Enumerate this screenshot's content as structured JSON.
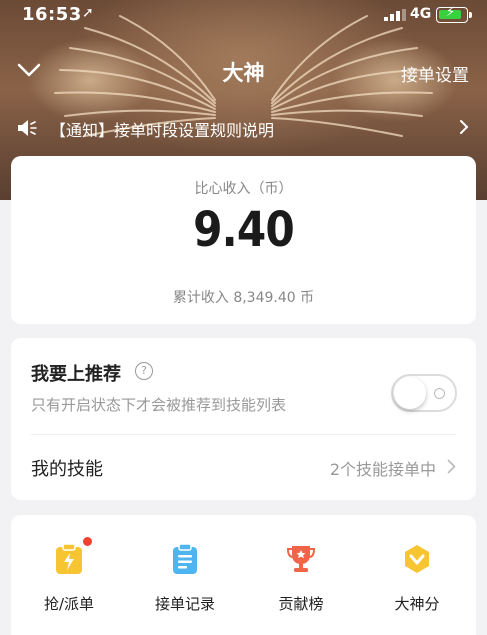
{
  "status_bar": {
    "time": "16:53",
    "network": "4G"
  },
  "nav": {
    "title": "大神",
    "right_action": "接单设置"
  },
  "notice": {
    "text": "【通知】接单时段设置规则说明"
  },
  "income": {
    "label": "比心收入（币）",
    "value": "9.40",
    "total_text": "累计收入 8,349.40 币"
  },
  "recommend": {
    "title": "我要上推荐",
    "help_symbol": "?",
    "description": "只有开启状态下才会被推荐到技能列表",
    "enabled": false
  },
  "skills": {
    "label": "我的技能",
    "count_text": "2个技能接单中"
  },
  "tools": [
    {
      "label": "抢/派单",
      "icon": "order-grab-icon",
      "badge": true
    },
    {
      "label": "接单记录",
      "icon": "order-record-icon",
      "badge": false
    },
    {
      "label": "贡献榜",
      "icon": "trophy-icon",
      "badge": false
    },
    {
      "label": "大神分",
      "icon": "score-shield-icon",
      "badge": false
    }
  ],
  "colors": {
    "icon_yellow": "#f7c531",
    "icon_blue": "#4fb5f0",
    "icon_red": "#f0654a",
    "badge_red": "#f0412f",
    "battery_green": "#3ad13f"
  }
}
